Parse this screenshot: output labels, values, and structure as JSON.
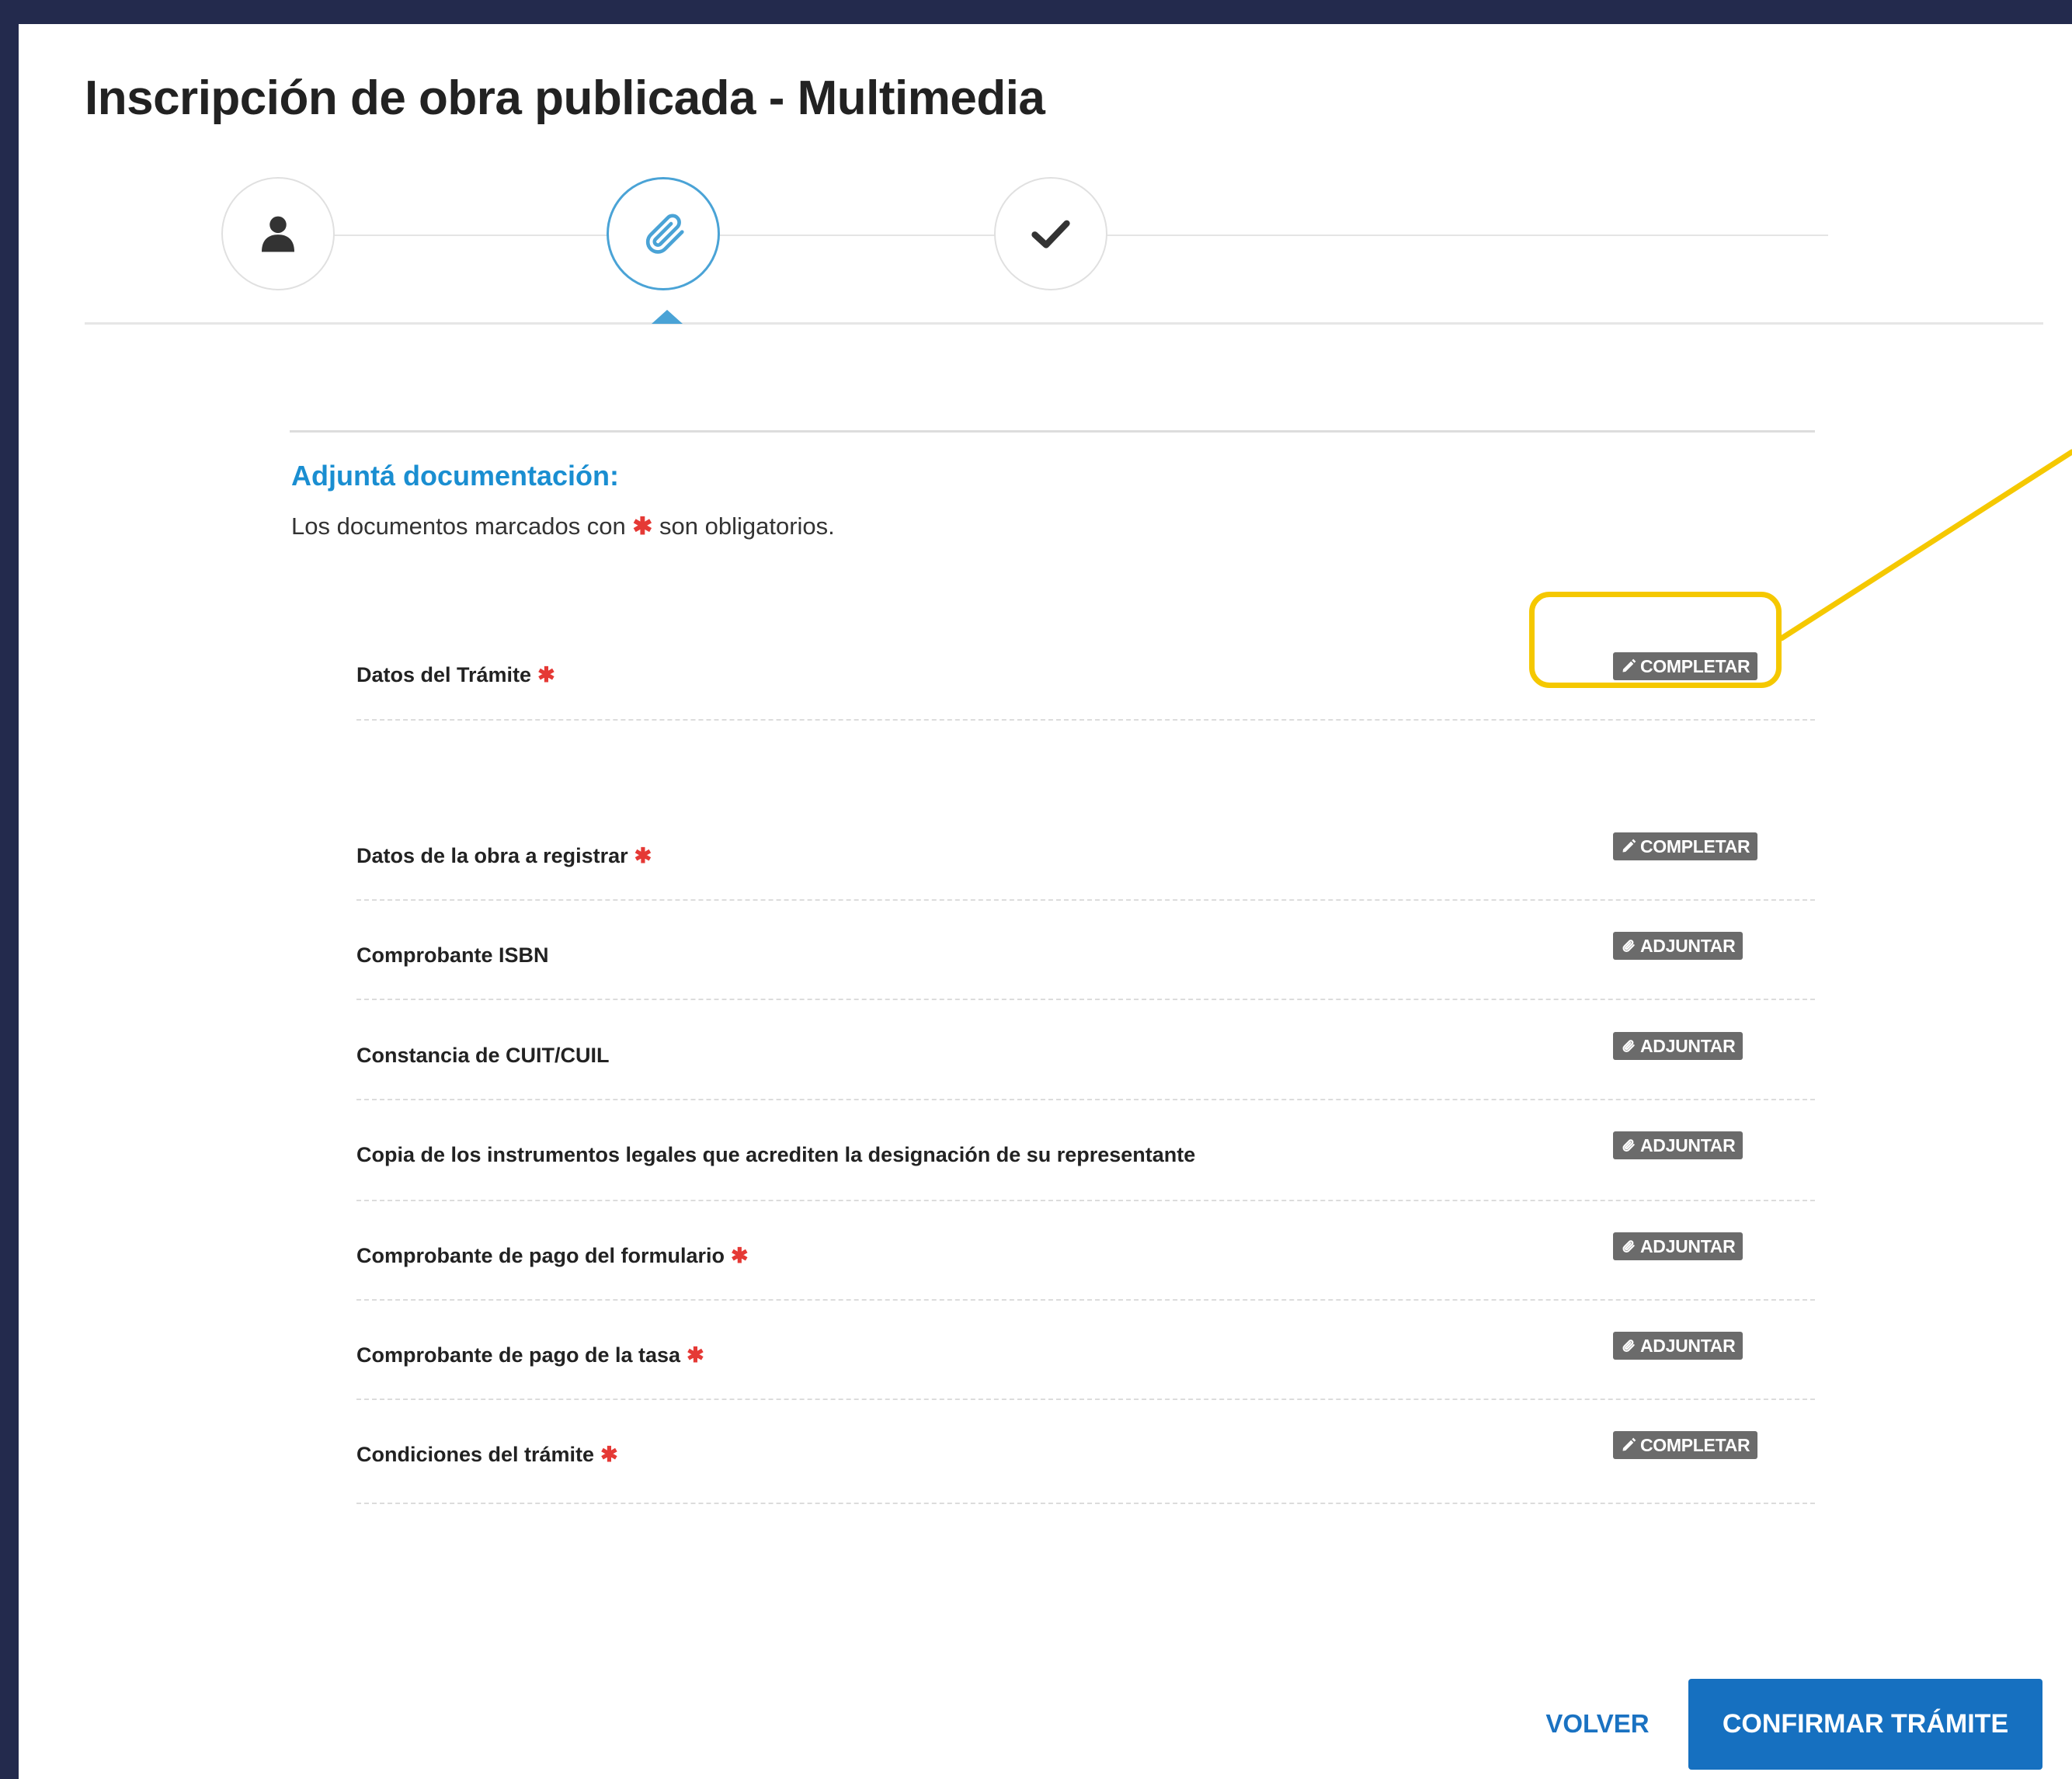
{
  "page": {
    "title": "Inscripción de obra publicada - Multimedia"
  },
  "stepper": {
    "steps": [
      {
        "icon": "user-icon",
        "state": "done"
      },
      {
        "icon": "paperclip-icon",
        "state": "active"
      },
      {
        "icon": "check-icon",
        "state": "pending"
      }
    ]
  },
  "section": {
    "title": "Adjuntá documentación:",
    "subtitle_before": "Los documentos marcados con",
    "required_mark": "✱",
    "subtitle_after": "son obligatorios."
  },
  "documents": [
    {
      "label": "Datos del Trámite",
      "required": true,
      "action": "COMPLETAR",
      "action_icon": "pencil-icon"
    },
    {
      "label": "Datos de la obra a registrar",
      "required": true,
      "action": "COMPLETAR",
      "action_icon": "pencil-icon"
    },
    {
      "label": "Comprobante ISBN",
      "required": false,
      "action": "ADJUNTAR",
      "action_icon": "paperclip-icon"
    },
    {
      "label": "Constancia de CUIT/CUIL",
      "required": false,
      "action": "ADJUNTAR",
      "action_icon": "paperclip-icon"
    },
    {
      "label": "Copia de los instrumentos legales que acrediten la designación de su representante",
      "required": false,
      "action": "ADJUNTAR",
      "action_icon": "paperclip-icon"
    },
    {
      "label": "Comprobante de pago del formulario",
      "required": true,
      "action": "ADJUNTAR",
      "action_icon": "paperclip-icon"
    },
    {
      "label": "Comprobante de pago de la tasa",
      "required": true,
      "action": "ADJUNTAR",
      "action_icon": "paperclip-icon"
    },
    {
      "label": "Condiciones del trámite",
      "required": true,
      "action": "COMPLETAR",
      "action_icon": "pencil-icon"
    }
  ],
  "footer": {
    "back_label": "VOLVER",
    "confirm_label": "CONFIRMAR TRÁMITE"
  },
  "colors": {
    "frame": "#232a4d",
    "accent": "#1a8ed1",
    "primary_button": "#1670c0",
    "required": "#e53935",
    "annotation": "#f5c800",
    "action_button": "#6b6b6b"
  }
}
